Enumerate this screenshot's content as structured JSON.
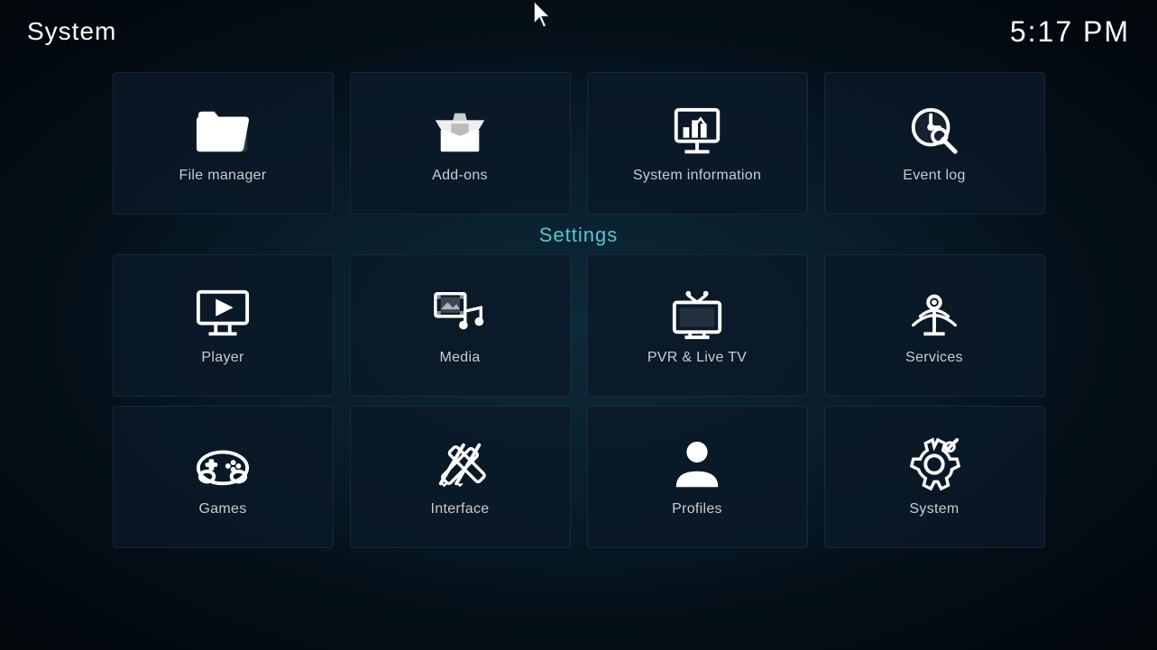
{
  "header": {
    "title": "System",
    "time": "5:17 PM"
  },
  "top_row": [
    {
      "id": "file-manager",
      "label": "File manager",
      "icon": "folder"
    },
    {
      "id": "add-ons",
      "label": "Add-ons",
      "icon": "addons"
    },
    {
      "id": "system-information",
      "label": "System information",
      "icon": "sysinfo"
    },
    {
      "id": "event-log",
      "label": "Event log",
      "icon": "eventlog"
    }
  ],
  "settings_label": "Settings",
  "settings_row1": [
    {
      "id": "player",
      "label": "Player",
      "icon": "player"
    },
    {
      "id": "media",
      "label": "Media",
      "icon": "media"
    },
    {
      "id": "pvr-live-tv",
      "label": "PVR & Live TV",
      "icon": "pvr"
    },
    {
      "id": "services",
      "label": "Services",
      "icon": "services"
    }
  ],
  "settings_row2": [
    {
      "id": "games",
      "label": "Games",
      "icon": "games"
    },
    {
      "id": "interface",
      "label": "Interface",
      "icon": "interface"
    },
    {
      "id": "profiles",
      "label": "Profiles",
      "icon": "profiles"
    },
    {
      "id": "system",
      "label": "System",
      "icon": "system"
    }
  ]
}
